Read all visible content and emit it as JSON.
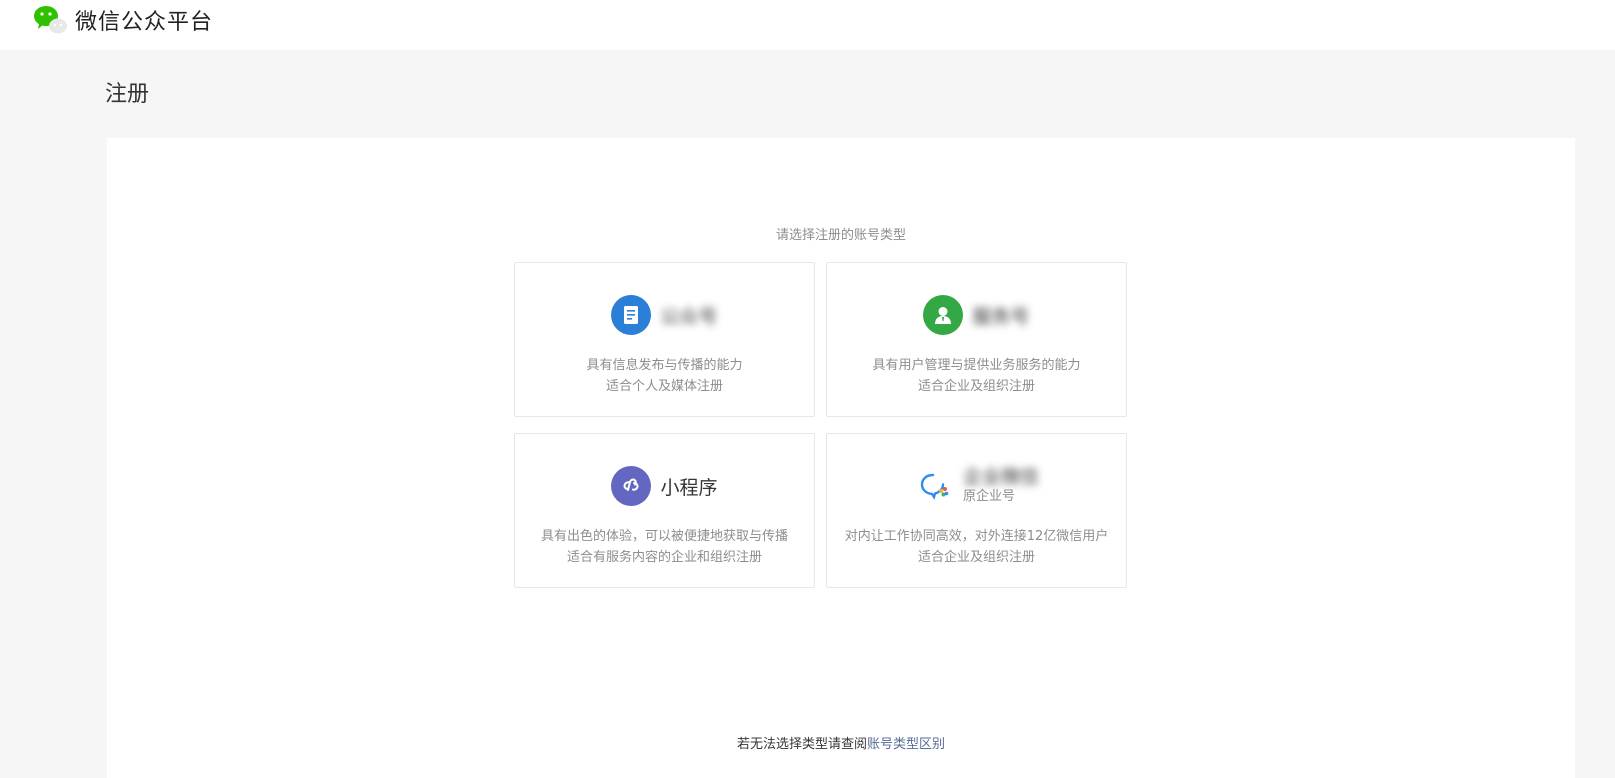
{
  "header": {
    "logo_icon": "wechat-logo-icon",
    "title": "微信公众平台",
    "brand_color": "#2dc100"
  },
  "page": {
    "heading": "注册"
  },
  "panel": {
    "prompt": "请选择注册的账号类型",
    "cards": [
      {
        "icon": "official-account-icon",
        "icon_color": "#2b7fd6",
        "title": "公众号",
        "desc_line1": "具有信息发布与传播的能力",
        "desc_line2": "适合个人及媒体注册"
      },
      {
        "icon": "service-account-icon",
        "icon_color": "#33a845",
        "title": "服务号",
        "desc_line1": "具有用户管理与提供业务服务的能力",
        "desc_line2": "适合企业及组织注册"
      },
      {
        "icon": "mini-program-icon",
        "icon_color": "#6467c1",
        "title": "小程序",
        "desc_line1": "具有出色的体验，可以被便捷地获取与传播",
        "desc_line2": "适合有服务内容的企业和组织注册"
      },
      {
        "icon": "wecom-icon",
        "icon_color": "#2f8cf0",
        "title": "企业微信",
        "subtitle": "原企业号",
        "desc_line1": "对内让工作协同高效，对外连接12亿微信用户",
        "desc_line2": "适合企业及组织注册"
      }
    ]
  },
  "footer": {
    "text": "若无法选择类型请查阅",
    "link": "账号类型区别"
  }
}
